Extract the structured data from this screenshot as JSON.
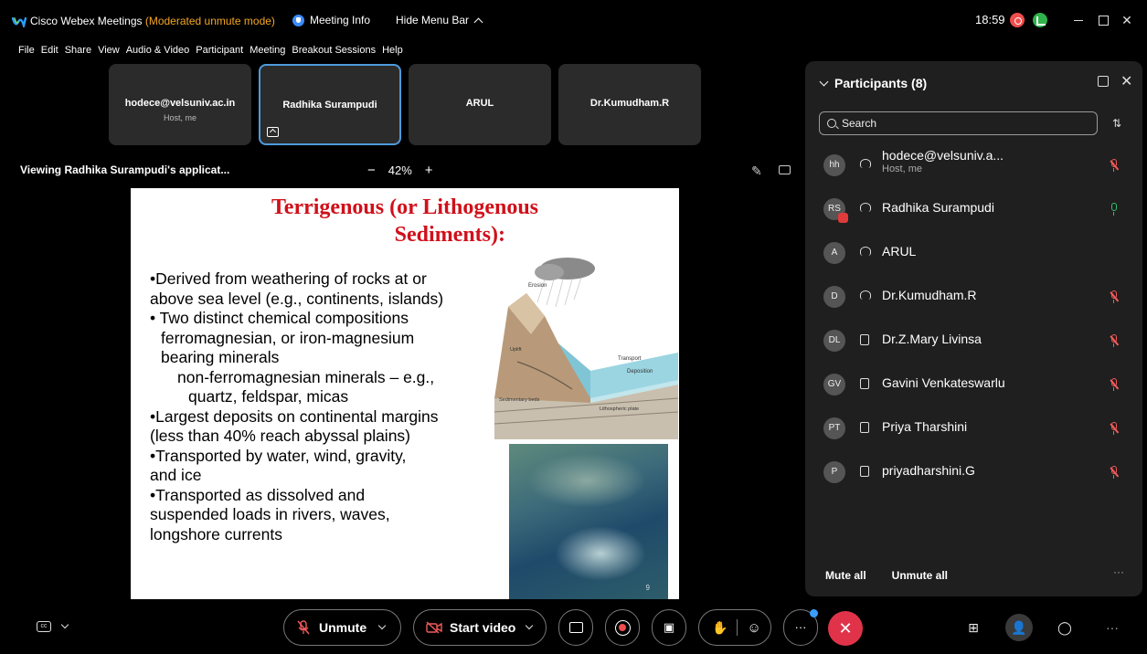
{
  "titlebar": {
    "app_name": "Cisco Webex Meetings",
    "mode": "(Moderated unmute mode)",
    "meeting_info": "Meeting Info",
    "hide_menu_bar": "Hide Menu Bar",
    "time": "18:59"
  },
  "menu": [
    "File",
    "Edit",
    "Share",
    "View",
    "Audio & Video",
    "Participant",
    "Meeting",
    "Breakout Sessions",
    "Help"
  ],
  "tiles": [
    {
      "name": "hodece@velsuniv.ac.in",
      "sub": "Host, me"
    },
    {
      "name": "Radhika Surampudi",
      "sub": ""
    },
    {
      "name": "ARUL",
      "sub": ""
    },
    {
      "name": "Dr.Kumudham.R",
      "sub": ""
    }
  ],
  "viewing": {
    "title": "Viewing Radhika Surampudi's applicat...",
    "zoom_minus": "−",
    "zoom_level": "42%",
    "zoom_plus": "+"
  },
  "slide": {
    "title_line1": "Terrigenous (or Lithogenous",
    "title_line2": "Sediments):",
    "bullets": [
      "•Derived from weathering of rocks at or",
      "above sea level (e.g., continents, islands)",
      "• Two distinct chemical compositions",
      "ferromagnesian, or iron-magnesium",
      "bearing minerals",
      "non-ferromagnesian minerals – e.g.,",
      "quartz, feldspar, micas",
      "•Largest deposits on continental margins",
      "(less than 40% reach abyssal plains)",
      "•Transported by water, wind, gravity,",
      "and ice",
      "•Transported as dissolved and",
      "suspended loads in rivers, waves,",
      "longshore currents"
    ],
    "illus_labels": {
      "erosion": "Erosion",
      "transport": "Transport",
      "deposition": "Deposition",
      "sedimentary_beds": "Sedimentary beds",
      "lithospheric_plate": "Lithospheric plate",
      "uplift": "Uplift"
    },
    "page_number": "9"
  },
  "participants": {
    "title": "Participants (8)",
    "search_placeholder": "Search",
    "list": [
      {
        "initials": "hh",
        "name": "hodece@velsuniv.a...",
        "sub": "Host, me",
        "device": "headset",
        "mic": "muted"
      },
      {
        "initials": "RS",
        "name": "Radhika Surampudi",
        "sub": "",
        "device": "headset",
        "mic": "on"
      },
      {
        "initials": "A",
        "name": "ARUL",
        "sub": "",
        "device": "headset",
        "mic": "none"
      },
      {
        "initials": "D",
        "name": "Dr.Kumudham.R",
        "sub": "",
        "device": "headset",
        "mic": "muted"
      },
      {
        "initials": "DL",
        "name": "Dr.Z.Mary Livinsa",
        "sub": "",
        "device": "phone",
        "mic": "muted"
      },
      {
        "initials": "GV",
        "name": "Gavini Venkateswarlu",
        "sub": "",
        "device": "phone",
        "mic": "muted"
      },
      {
        "initials": "PT",
        "name": "Priya Tharshini",
        "sub": "",
        "device": "phone",
        "mic": "muted"
      },
      {
        "initials": "P",
        "name": "priyadharshini.G",
        "sub": "",
        "device": "phone",
        "mic": "muted"
      }
    ],
    "mute_all": "Mute all",
    "unmute_all": "Unmute all"
  },
  "toolbar": {
    "unmute": "Unmute",
    "start_video": "Start video"
  },
  "colors": {
    "accent_blue": "#4e9bdc",
    "end_red": "#e0334a",
    "muted_red": "#f25b5b",
    "mic_on_green": "#2cc36b",
    "mode_orange": "#f5a623",
    "slide_title_red": "#d0101a"
  }
}
